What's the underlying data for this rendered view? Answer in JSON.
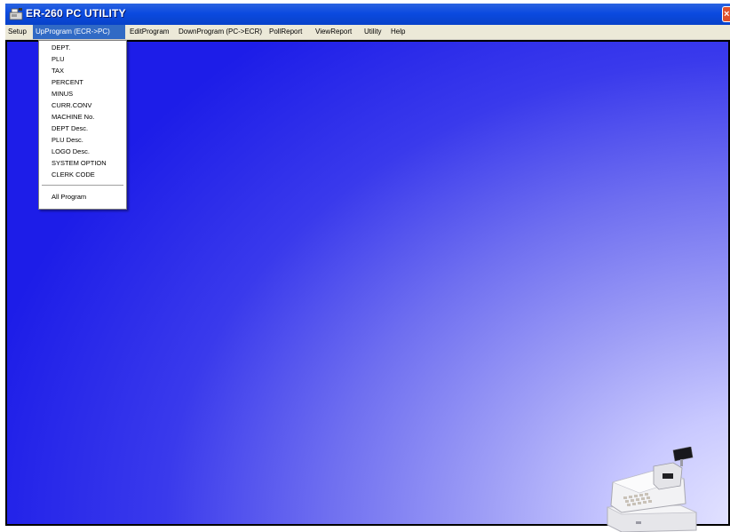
{
  "window": {
    "title": "ER-260 PC UTILITY"
  },
  "menubar": {
    "items": [
      {
        "label": "Setup"
      },
      {
        "label": "UpProgram (ECR->PC)"
      },
      {
        "label": "EditProgram"
      },
      {
        "label": "DownProgram (PC->ECR)"
      },
      {
        "label": "PollReport"
      },
      {
        "label": "ViewReport"
      },
      {
        "label": "Utility"
      },
      {
        "label": "Help"
      }
    ],
    "active": "UpProgram (ECR->PC)"
  },
  "dropdown": {
    "items": [
      {
        "label": "DEPT."
      },
      {
        "label": "PLU"
      },
      {
        "label": "TAX"
      },
      {
        "label": "PERCENT"
      },
      {
        "label": "MINUS"
      },
      {
        "label": "CURR.CONV"
      },
      {
        "label": "MACHINE No."
      },
      {
        "label": "DEPT Desc."
      },
      {
        "label": "PLU Desc."
      },
      {
        "label": "LOGO Desc."
      },
      {
        "label": "SYSTEM OPTION"
      },
      {
        "label": "CLERK CODE"
      },
      {
        "label": "All Program"
      }
    ]
  },
  "icons": {
    "app": "cash-register-app-icon",
    "close": "close-icon",
    "register": "cash-register-illustration"
  },
  "colors": {
    "titlebar": "#0b4ae0",
    "menu_highlight": "#316ac5",
    "background_blue": "#1d1de8",
    "background_light": "#e8e8ff",
    "close_button": "#e0502a"
  }
}
